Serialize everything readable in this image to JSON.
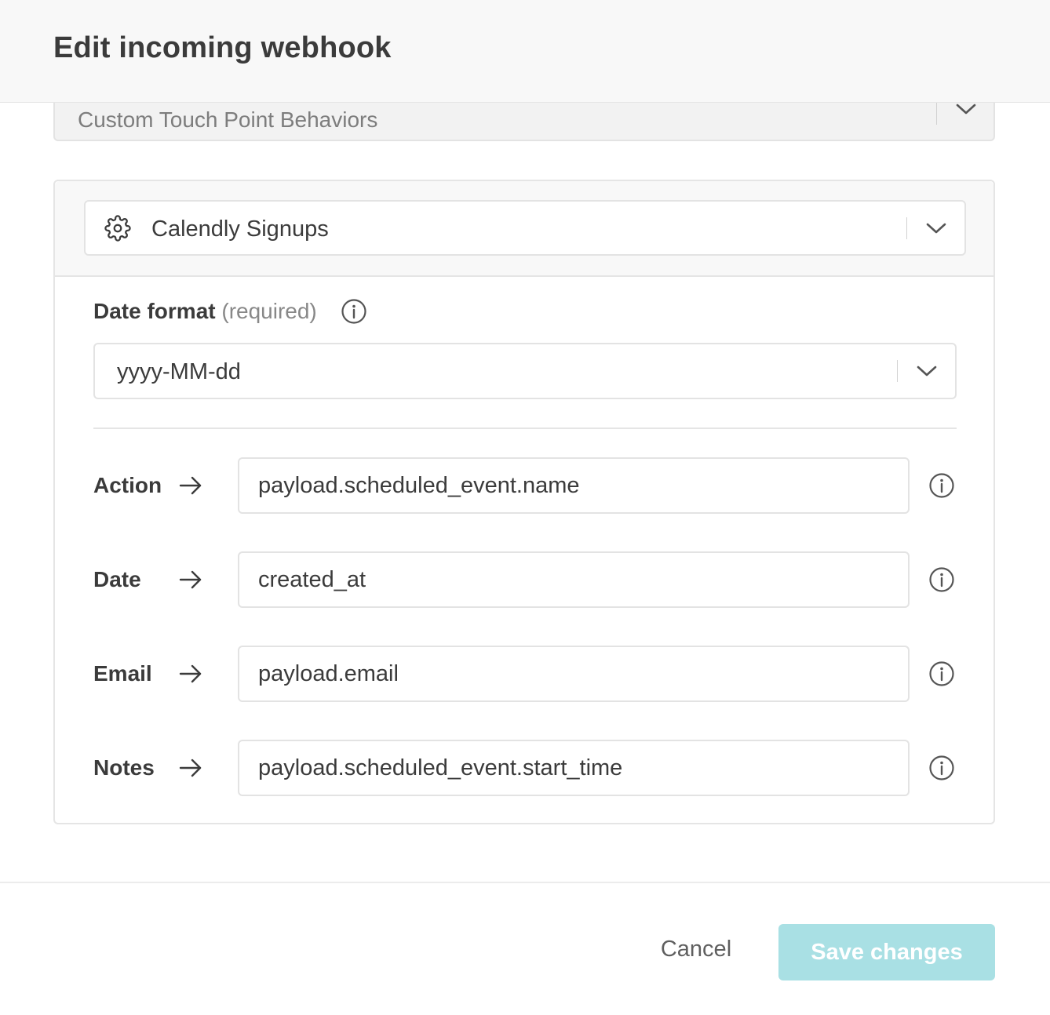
{
  "dialog": {
    "title": "Edit incoming webhook"
  },
  "behavior_select": {
    "value": "Custom Touch Point Behaviors",
    "icon": "chevron-down-icon"
  },
  "source_select": {
    "value": "Calendly Signups",
    "icon": "gear-icon"
  },
  "date_format": {
    "label": "Date format",
    "required_text": "(required)",
    "value": "yyyy-MM-dd",
    "info_icon": "info-icon"
  },
  "mappings": [
    {
      "label": "Action",
      "value": "payload.scheduled_event.name"
    },
    {
      "label": "Date",
      "value": "created_at"
    },
    {
      "label": "Email",
      "value": "payload.email"
    },
    {
      "label": "Notes",
      "value": "payload.scheduled_event.start_time"
    }
  ],
  "footer": {
    "cancel_label": "Cancel",
    "save_label": "Save changes"
  },
  "colors": {
    "primary_disabled": "#a9e0e4",
    "border": "#e3e3e3",
    "text": "#3b3b3b"
  }
}
